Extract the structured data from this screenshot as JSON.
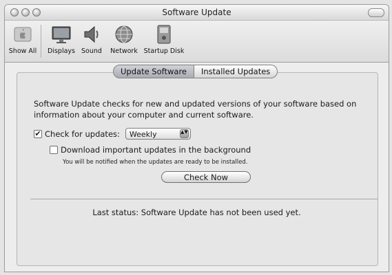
{
  "window": {
    "title": "Software Update"
  },
  "toolbar": {
    "items": [
      {
        "label": "Show All",
        "icon": "apple-icon"
      },
      {
        "label": "Displays",
        "icon": "display-icon"
      },
      {
        "label": "Sound",
        "icon": "speaker-icon"
      },
      {
        "label": "Network",
        "icon": "globe-icon"
      },
      {
        "label": "Startup Disk",
        "icon": "disk-icon"
      }
    ]
  },
  "tabs": [
    {
      "label": "Update Software",
      "selected": true
    },
    {
      "label": "Installed Updates",
      "selected": false
    }
  ],
  "main": {
    "description": "Software Update checks for new and updated versions of your software based on information about your computer and current software.",
    "check_label": "Check for updates:",
    "check_checked": true,
    "frequency": "Weekly",
    "download_label": "Download important updates in the background",
    "download_checked": false,
    "download_note": "You will be notified when the updates are ready to be installed.",
    "check_now": "Check Now",
    "status": "Last status:  Software Update has not been used yet."
  },
  "glyphs": {
    "checkmark": "✔",
    "stepper": "▲▼"
  }
}
